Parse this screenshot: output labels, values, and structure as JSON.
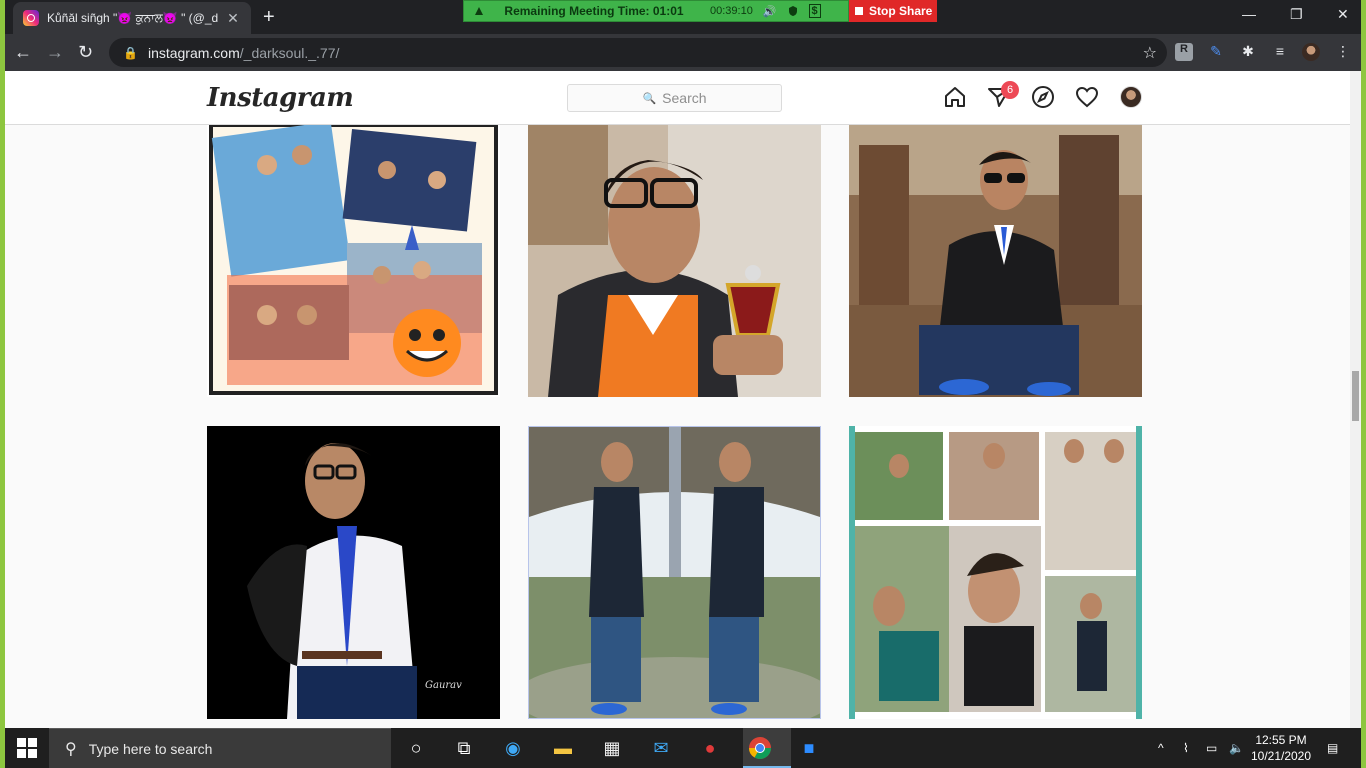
{
  "browser": {
    "tab_title": "Kůñăl siñgh \"👿 ਕੁਨਾਲ👿 \" (@_d",
    "tab_close": "✕",
    "new_tab": "+",
    "url_host": "instagram.com",
    "url_path": "/_darksoul._.77/",
    "window_controls": [
      "—",
      "❐",
      "✕"
    ]
  },
  "zoom": {
    "remaining": "Remaining Meeting Time: 01:01",
    "elapsed": "00:39:10",
    "stop_share": "Stop Share"
  },
  "instagram": {
    "logo": "Instagram",
    "search_placeholder": "Search",
    "direct_badge": "6",
    "posts": [
      {
        "kind": "collage-selfies"
      },
      {
        "kind": "boy-with-trophy"
      },
      {
        "kind": "boy-on-bench"
      },
      {
        "kind": "boy-in-suit"
      },
      {
        "kind": "boy-mirror-split"
      },
      {
        "kind": "collage-friends"
      }
    ],
    "nav_icons": [
      "home-icon",
      "direct-icon",
      "explore-icon",
      "heart-icon",
      "profile-avatar"
    ]
  },
  "taskbar": {
    "search_text": "Type here to search",
    "time": "12:55 PM",
    "date": "10/21/2020"
  },
  "colors": {
    "zoom_green": "#3fb44a",
    "stop_red": "#e02828",
    "ig_badge": "#ed4956",
    "frame_green": "#8dc63f"
  }
}
